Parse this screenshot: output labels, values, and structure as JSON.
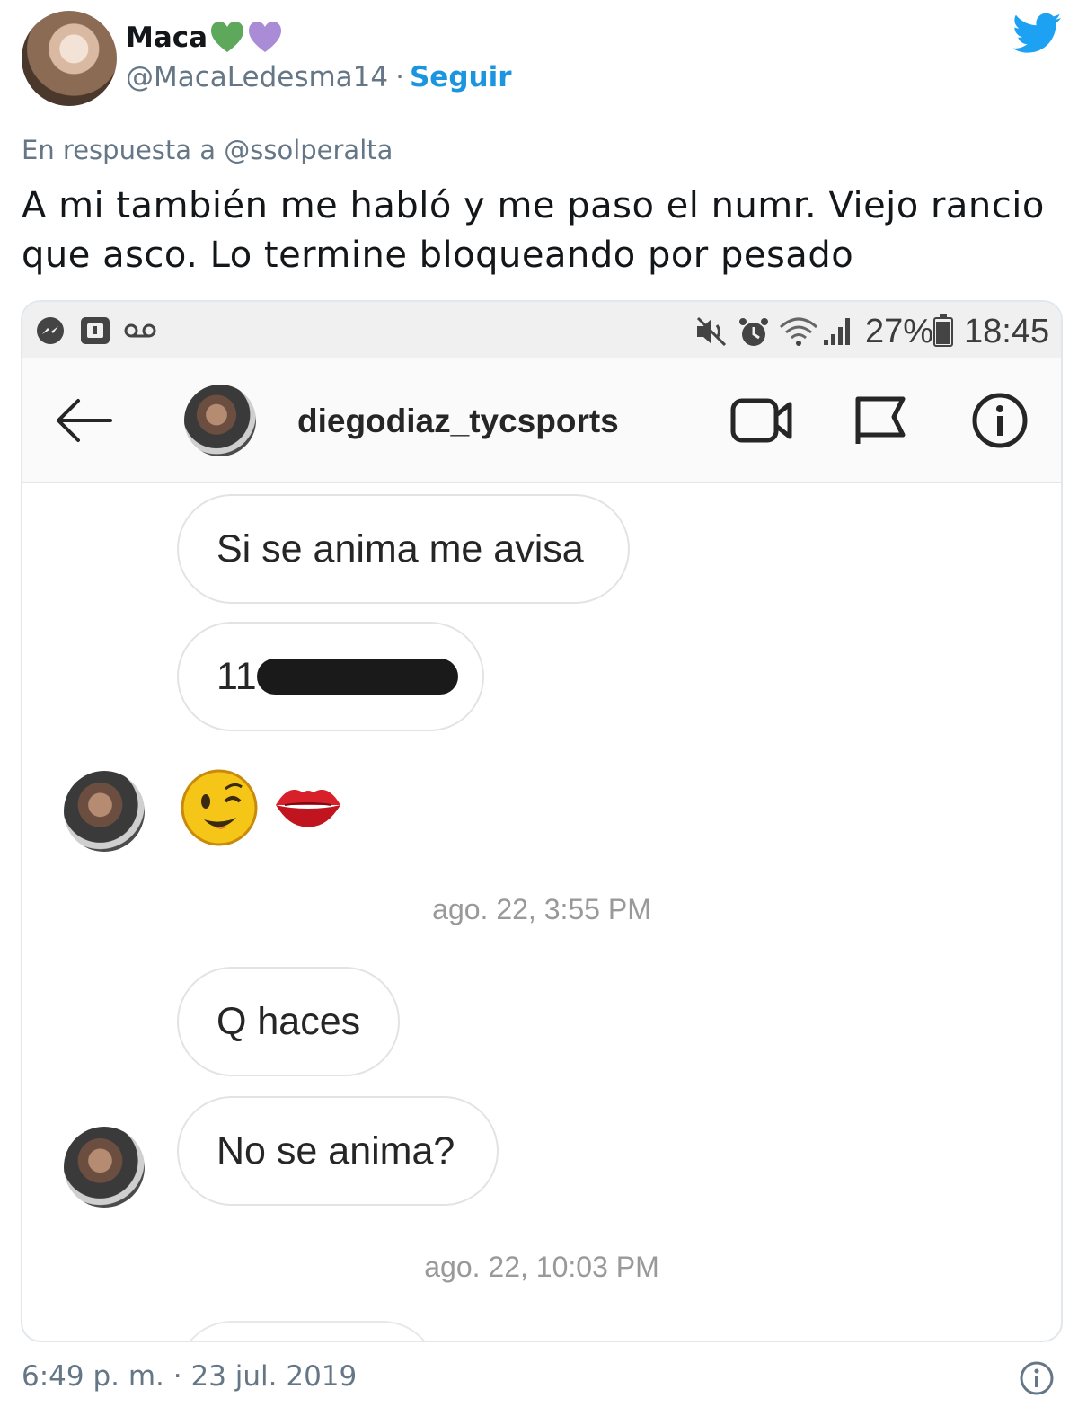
{
  "tweet": {
    "author_name": "Maca",
    "handle": "@MacaLedesma14",
    "separator": "·",
    "follow_label": "Seguir",
    "reply_to": "En respuesta a @ssolperalta",
    "text": "A mi también me habló y me paso el numr. Viejo rancio que asco. Lo termine bloqueando por pesado",
    "timestamp": "6:49 p. m. · 23 jul. 2019",
    "icons": [
      "green-heart-icon",
      "purple-heart-icon",
      "twitter-bird-icon",
      "info-icon"
    ],
    "colors": {
      "link": "#1b95e0",
      "muted": "#657786",
      "green_heart": "#5ea85c",
      "purple_heart": "#a98bd6"
    }
  },
  "screenshot": {
    "status_bar": {
      "battery": "27%",
      "time": "18:45",
      "left_icons": [
        "messenger-icon",
        "notification-icon",
        "voicemail-icon"
      ],
      "right_icons": [
        "mute-icon",
        "alarm-icon",
        "wifi-icon",
        "signal-icon",
        "battery-icon"
      ]
    },
    "header": {
      "username": "diegodiaz_tycsports",
      "icons": [
        "back-arrow-icon",
        "video-call-icon",
        "flag-icon",
        "info-icon"
      ]
    },
    "messages": [
      {
        "text": "Si se anima me avisa"
      },
      {
        "text": "11",
        "redacted": true
      },
      {
        "emoji": "wink-face-kiss-lips"
      },
      {
        "timestamp": "ago. 22, 3:55 PM"
      },
      {
        "text": "Q haces"
      },
      {
        "text": "No se anima?"
      },
      {
        "timestamp": "ago. 22, 10:03 PM"
      }
    ]
  }
}
